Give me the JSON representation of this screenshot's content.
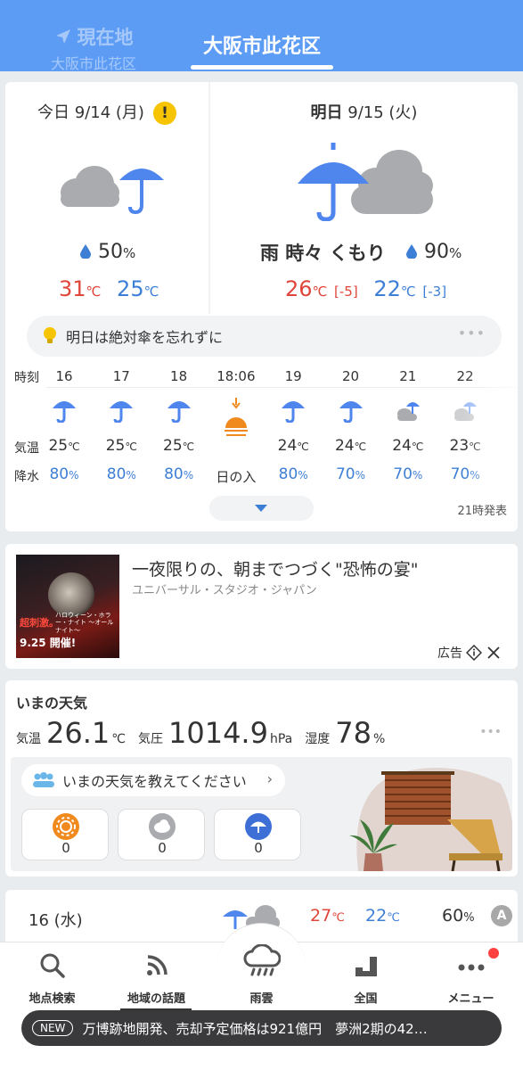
{
  "header": {
    "current_location_label": "現在地",
    "current_location_city": "大阪市此花区",
    "selected_tab": "大阪市此花区"
  },
  "forecast": {
    "today": {
      "title": "今日 9/14 (月)",
      "warning_mark": "!",
      "pop_value": "50",
      "pop_unit": "%",
      "max_temp": "31",
      "min_temp": "25",
      "temp_unit": "℃"
    },
    "tomorrow": {
      "title_bold": "明日",
      "title_rest": "9/15 (火)",
      "weather": "雨 時々 くもり",
      "pop_value": "90",
      "pop_unit": "%",
      "max_temp": "26",
      "max_diff": "[-5]",
      "min_temp": "22",
      "min_diff": "[-3]",
      "temp_unit": "℃"
    },
    "tip": "明日は絶対傘を忘れずに",
    "tip_more": "•••",
    "hourly_labels": {
      "time": "時刻",
      "temp": "気温",
      "precip": "降水"
    },
    "hourly": [
      {
        "time": "16",
        "icon": "rain-icon",
        "temp": "25",
        "precip": "80"
      },
      {
        "time": "17",
        "icon": "rain-icon",
        "temp": "25",
        "precip": "80"
      },
      {
        "time": "18",
        "icon": "rain-icon",
        "temp": "25",
        "precip": "80"
      },
      {
        "time": "18:06",
        "icon": "sunset-icon",
        "temp": "",
        "precip_text": "日の入"
      },
      {
        "time": "19",
        "icon": "rain-icon",
        "temp": "24",
        "precip": "80"
      },
      {
        "time": "20",
        "icon": "rain-icon",
        "temp": "24",
        "precip": "70"
      },
      {
        "time": "21",
        "icon": "cloud-rain-icon",
        "temp": "24",
        "precip": "70"
      },
      {
        "time": "22",
        "icon": "cloud-rain-icon",
        "temp": "23",
        "precip": "70"
      }
    ],
    "issued": "21時発表"
  },
  "ad": {
    "title": "一夜限りの、朝までつづく\"恐怖の宴\"",
    "sponsor": "ユニバーサル・スタジオ・ジャパン",
    "label": "広告",
    "image_text_event": "ハロウィーン・ホラー・ナイト ～オールナイト～",
    "image_text_red": "超刺激。",
    "image_text_date": "9.25 開催!"
  },
  "current": {
    "heading": "いまの天気",
    "temp_label": "気温",
    "temp_value": "26.1",
    "temp_unit": "℃",
    "pressure_label": "気圧",
    "pressure_value": "1014.9",
    "pressure_unit": "hPa",
    "humidity_label": "湿度",
    "humidity_value": "78",
    "humidity_unit": "%",
    "ask_text": "いまの天気を教えてください",
    "votes": [
      {
        "icon": "sun-icon",
        "count": "0"
      },
      {
        "icon": "cloud-icon",
        "count": "0"
      },
      {
        "icon": "umbrella-icon",
        "count": "0"
      }
    ]
  },
  "daily": {
    "date": "16 (水)",
    "max_temp": "27",
    "min_temp": "22",
    "temp_unit": "℃",
    "pop": "60",
    "pop_unit": "%",
    "badge": "A"
  },
  "nav": {
    "items": [
      {
        "label": "地点検索",
        "icon": "search-icon"
      },
      {
        "label": "地域の話題",
        "icon": "rss-icon"
      },
      {
        "label": "雨雲",
        "icon": "rain-cloud-icon"
      },
      {
        "label": "全国",
        "icon": "bar-chart-icon"
      },
      {
        "label": "メニュー",
        "icon": "more-icon"
      }
    ]
  },
  "ticker": {
    "badge": "NEW",
    "text": "万博跡地開発、売却予定価格は921億円　夢洲2期の42…"
  },
  "colors": {
    "header_blue": "#5d9cf5",
    "rain_blue": "#4f86ee",
    "temp_red": "#e0453a",
    "temp_blue": "#3e7fd6"
  }
}
